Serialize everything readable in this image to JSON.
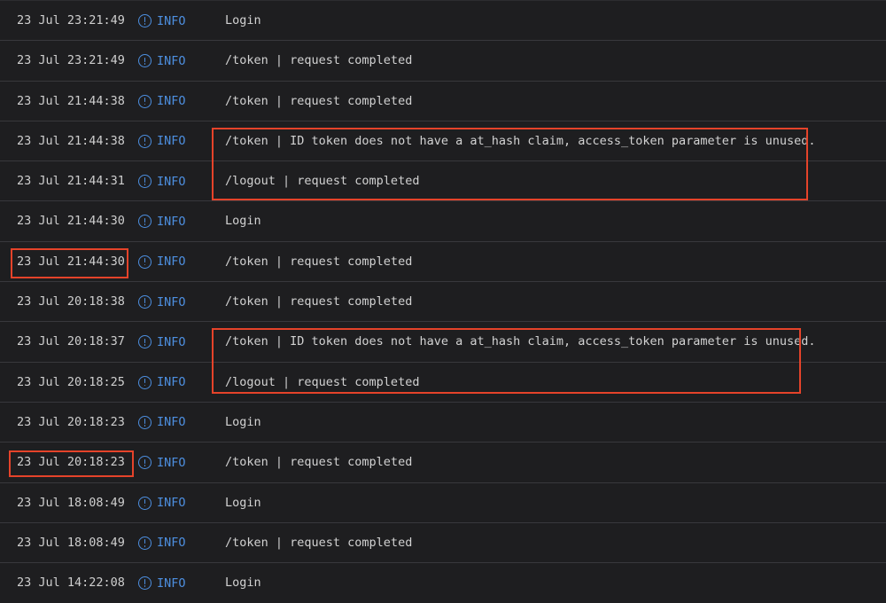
{
  "log": {
    "rows": [
      {
        "timestamp": "23 Jul 23:21:49",
        "level": "INFO",
        "message": "Login"
      },
      {
        "timestamp": "23 Jul 23:21:49",
        "level": "INFO",
        "message": "/token | request completed"
      },
      {
        "timestamp": "23 Jul 21:44:38",
        "level": "INFO",
        "message": "/token | request completed"
      },
      {
        "timestamp": "23 Jul 21:44:38",
        "level": "INFO",
        "message": "/token | ID token does not have a at_hash claim, access_token parameter is unused."
      },
      {
        "timestamp": "23 Jul 21:44:31",
        "level": "INFO",
        "message": "/logout | request completed"
      },
      {
        "timestamp": "23 Jul 21:44:30",
        "level": "INFO",
        "message": "Login"
      },
      {
        "timestamp": "23 Jul 21:44:30",
        "level": "INFO",
        "message": "/token | request completed"
      },
      {
        "timestamp": "23 Jul 20:18:38",
        "level": "INFO",
        "message": "/token | request completed"
      },
      {
        "timestamp": "23 Jul 20:18:37",
        "level": "INFO",
        "message": "/token | ID token does not have a at_hash claim, access_token parameter is unused."
      },
      {
        "timestamp": "23 Jul 20:18:25",
        "level": "INFO",
        "message": "/logout | request completed"
      },
      {
        "timestamp": "23 Jul 20:18:23",
        "level": "INFO",
        "message": "Login"
      },
      {
        "timestamp": "23 Jul 20:18:23",
        "level": "INFO",
        "message": "/token | request completed"
      },
      {
        "timestamp": "23 Jul 18:08:49",
        "level": "INFO",
        "message": "Login"
      },
      {
        "timestamp": "23 Jul 18:08:49",
        "level": "INFO",
        "message": "/token | request completed"
      },
      {
        "timestamp": "23 Jul 14:22:08",
        "level": "INFO",
        "message": "Login"
      }
    ]
  },
  "colors": {
    "background": "#1e1e20",
    "info_level": "#4d8fe0",
    "highlight_box": "#e5432a"
  },
  "icons": {
    "level": "info-circle-icon"
  }
}
